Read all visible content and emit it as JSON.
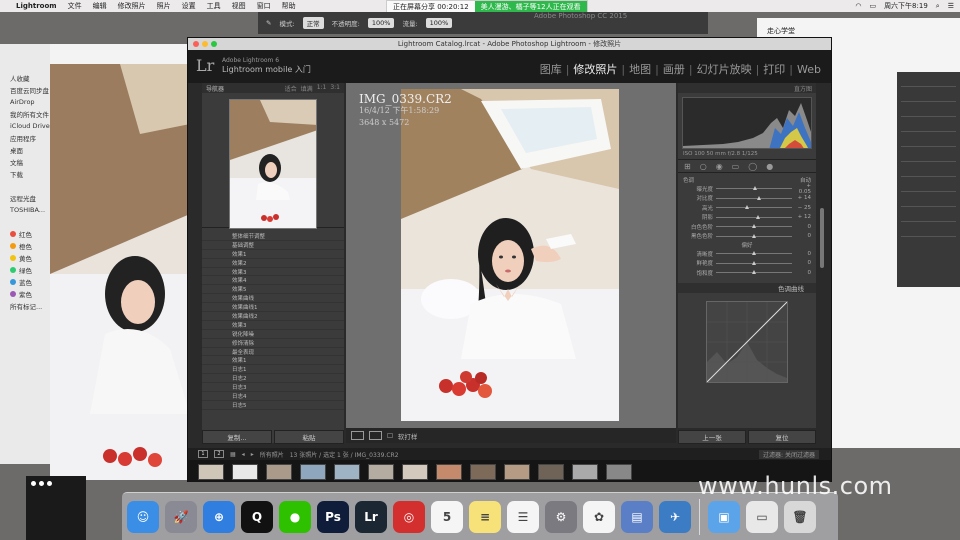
{
  "menubar": {
    "app": "Lightroom",
    "items": [
      "文件",
      "编辑",
      "修改照片",
      "照片",
      "设置",
      "工具",
      "视图",
      "窗口",
      "帮助"
    ],
    "clock": "周六下午8:19"
  },
  "screen_share": {
    "status": "正在屏幕分享 00:20:12",
    "notice": "美人漫游、橘子等12人正在观看"
  },
  "behind_ps": {
    "title": "Adobe Photoshop CC 2015",
    "mode_label": "模式:",
    "mode_value": "正常",
    "opacity_label": "不透明度:",
    "opacity_value": "100%",
    "flow_label": "流量:",
    "flow_value": "100%"
  },
  "right_window": {
    "title": "走心学堂"
  },
  "finder": {
    "sidebar": [
      "人收藏",
      "百度云同步盘",
      "AirDrop",
      "我的所有文件",
      "iCloud Drive",
      "应用程序",
      "桌面",
      "文稿",
      "下载",
      "",
      "远程光盘",
      "TOSHIBA...",
      "",
      "红色",
      "橙色",
      "黄色",
      "绿色",
      "蓝色",
      "紫色",
      "所有标记..."
    ],
    "tag_colors": [
      "#e84d3d",
      "#f39c12",
      "#f1c40f",
      "#2ecc71",
      "#3498db",
      "#9b59b6"
    ]
  },
  "lightroom": {
    "title": "Lightroom Catalog.lrcat - Adobe Photoshop Lightroom - 修改照片",
    "identity_small": "Adobe Lightroom 6",
    "identity": "Lightroom mobile 入门",
    "modules": [
      "图库",
      "修改照片",
      "地图",
      "画册",
      "幻灯片放映",
      "打印",
      "Web"
    ],
    "active_module": "修改照片",
    "navigator": {
      "label": "导航器",
      "zoom_opts": [
        "适合",
        "填满",
        "1:1",
        "3:1"
      ]
    },
    "history": [
      "整体细节调整",
      "基础调整",
      "效果1",
      "效果2",
      "效果3",
      "效果4",
      "效果5",
      "效果曲线",
      "效果曲线1",
      "效果曲线2",
      "效果3",
      "锐化降噪",
      "修饰清除",
      "最全表现",
      "效果1",
      "日志1",
      "日志2",
      "日志3",
      "日志4",
      "日志5"
    ],
    "copy_btn": "复制...",
    "paste_btn": "粘贴",
    "photo": {
      "filename": "IMG_0339.CR2",
      "datetime": "16/4/12 下午1:58:29",
      "dims": "3648 x 5472"
    },
    "toolbar_label": "软打样",
    "histogram": {
      "label": "直方图",
      "info": "ISO 100   50 mm   f/2.8   1/125"
    },
    "basic": {
      "label": "色调",
      "auto": "自动",
      "sliders": [
        {
          "name": "曝光度",
          "value": "+ 0.05",
          "pos": 0.52
        },
        {
          "name": "对比度",
          "value": "+ 14",
          "pos": 0.57
        },
        {
          "name": "高光",
          "value": "− 25",
          "pos": 0.42
        },
        {
          "name": "阴影",
          "value": "+ 12",
          "pos": 0.56
        },
        {
          "name": "白色色阶",
          "value": "0",
          "pos": 0.5
        },
        {
          "name": "黑色色阶",
          "value": "0",
          "pos": 0.5
        }
      ],
      "presence_label": "偏好",
      "presence": [
        {
          "name": "清晰度",
          "value": "0",
          "pos": 0.5
        },
        {
          "name": "鲜艳度",
          "value": "0",
          "pos": 0.5
        },
        {
          "name": "饱和度",
          "value": "0",
          "pos": 0.5
        }
      ]
    },
    "curve_label": "色调曲线",
    "prev_btn": "上一张",
    "reset_btn": "复位",
    "filmstrip": {
      "source": "所有照片",
      "count": "13 张照片 / 选定 1 张 / IMG_0339.CR2",
      "filter_label": "过滤器:",
      "filter_value": "关闭过滤器"
    }
  },
  "dock": {
    "apps": [
      {
        "name": "finder",
        "color": "#3a8ee6",
        "glyph": "☺"
      },
      {
        "name": "launchpad",
        "color": "#8a8a95",
        "glyph": "🚀"
      },
      {
        "name": "safari",
        "color": "#2f7ee0",
        "glyph": "⊕"
      },
      {
        "name": "qq",
        "color": "#111111",
        "glyph": "Q"
      },
      {
        "name": "wechat",
        "color": "#2dc100",
        "glyph": "●"
      },
      {
        "name": "photoshop",
        "color": "#0f1d3a",
        "glyph": "Ps"
      },
      {
        "name": "lightroom",
        "color": "#1c2734",
        "glyph": "Lr"
      },
      {
        "name": "netease-music",
        "color": "#d42f2f",
        "glyph": "◎"
      },
      {
        "name": "calendar",
        "color": "#f5f5f5",
        "glyph": "5"
      },
      {
        "name": "notes",
        "color": "#f7e27a",
        "glyph": "≡"
      },
      {
        "name": "reminders",
        "color": "#f5f5f5",
        "glyph": "☰"
      },
      {
        "name": "system-prefs",
        "color": "#7a7a80",
        "glyph": "⚙"
      },
      {
        "name": "photos",
        "color": "#f5f5f5",
        "glyph": "✿"
      },
      {
        "name": "keynote",
        "color": "#5a7fc7",
        "glyph": "▤"
      },
      {
        "name": "xcode",
        "color": "#3b7cc4",
        "glyph": "✈"
      }
    ],
    "right": [
      {
        "name": "downloads-folder",
        "color": "#5ba4ea",
        "glyph": "▣"
      },
      {
        "name": "document",
        "color": "#e8e8e8",
        "glyph": "▭"
      },
      {
        "name": "trash",
        "color": "#d8d8d8",
        "glyph": "🗑"
      }
    ]
  },
  "watermark": "www.hunls.com"
}
